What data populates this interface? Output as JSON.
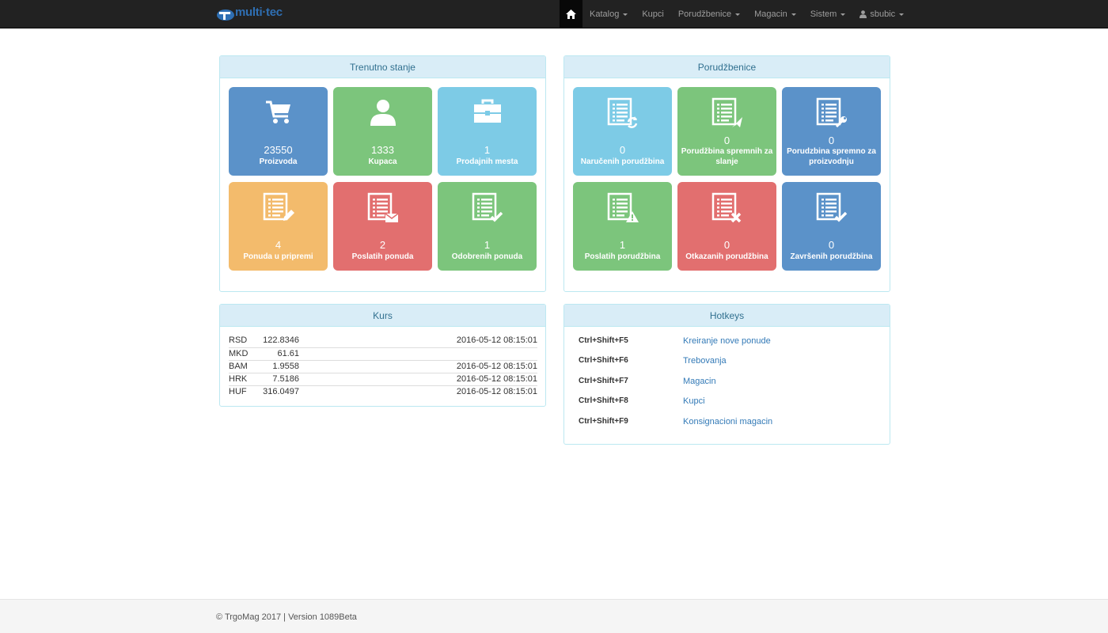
{
  "brand": {
    "name": "multi·tec"
  },
  "nav": {
    "home": "home-icon",
    "items": [
      {
        "label": "Katalog",
        "dropdown": true
      },
      {
        "label": "Kupci",
        "dropdown": false
      },
      {
        "label": "Porudžbenice",
        "dropdown": true
      },
      {
        "label": "Magacin",
        "dropdown": true
      },
      {
        "label": "Sistem",
        "dropdown": true
      },
      {
        "label": "sbubic",
        "dropdown": true,
        "icon": "user-icon"
      }
    ]
  },
  "trenutno": {
    "title": "Trenutno stanje",
    "tiles": [
      {
        "value": "23550",
        "label": "Proizvoda",
        "icon": "cart-icon",
        "color": "#5b92c9"
      },
      {
        "value": "1333",
        "label": "Kupaca",
        "icon": "user-icon",
        "color": "#7cc57c"
      },
      {
        "value": "1",
        "label": "Prodajnih mesta",
        "icon": "briefcase-icon",
        "color": "#7dcbe6"
      },
      {
        "value": "4",
        "label": "Ponuda u pripremi",
        "icon": "list-edit-icon",
        "color": "#f3bb6c"
      },
      {
        "value": "2",
        "label": "Poslatih ponuda",
        "icon": "list-mail-icon",
        "color": "#e26f6f"
      },
      {
        "value": "1",
        "label": "Odobrenih ponuda",
        "icon": "list-check-icon",
        "color": "#7cc57c"
      }
    ]
  },
  "porudzbenice": {
    "title": "Porudžbenice",
    "tiles": [
      {
        "value": "0",
        "label": "Naručenih porudžbina",
        "icon": "list-refresh-icon",
        "color": "#7dcbe6"
      },
      {
        "value": "0",
        "label": "Porudžbina spremnih za slanje",
        "icon": "list-send-icon",
        "color": "#7cc57c"
      },
      {
        "value": "0",
        "label": "Porudzbina spremno za proizvodnju",
        "icon": "list-wrench-icon",
        "color": "#5b92c9"
      },
      {
        "value": "1",
        "label": "Poslatih porudžbina",
        "icon": "list-warning-icon",
        "color": "#7cc57c"
      },
      {
        "value": "0",
        "label": "Otkazanih porudžbina",
        "icon": "list-cancel-icon",
        "color": "#e26f6f"
      },
      {
        "value": "0",
        "label": "Završenih porudžbina",
        "icon": "list-check-icon",
        "color": "#5b92c9"
      }
    ]
  },
  "kurs": {
    "title": "Kurs",
    "rows": [
      {
        "code": "RSD",
        "rate": "122.8346",
        "date": "2016-05-12 08:15:01"
      },
      {
        "code": "MKD",
        "rate": "61.61",
        "date": ""
      },
      {
        "code": "BAM",
        "rate": "1.9558",
        "date": "2016-05-12 08:15:01"
      },
      {
        "code": "HRK",
        "rate": "7.5186",
        "date": "2016-05-12 08:15:01"
      },
      {
        "code": "HUF",
        "rate": "316.0497",
        "date": "2016-05-12 08:15:01"
      }
    ]
  },
  "hotkeys": {
    "title": "Hotkeys",
    "items": [
      {
        "key": "Ctrl+Shift+F5",
        "action": "Kreiranje nove ponude"
      },
      {
        "key": "Ctrl+Shift+F6",
        "action": "Trebovanja"
      },
      {
        "key": "Ctrl+Shift+F7",
        "action": "Magacin"
      },
      {
        "key": "Ctrl+Shift+F8",
        "action": "Kupci"
      },
      {
        "key": "Ctrl+Shift+F9",
        "action": "Konsignacioni magacin"
      }
    ]
  },
  "footer": {
    "text": "© TrgoMag 2017 | Version 1089Beta"
  }
}
